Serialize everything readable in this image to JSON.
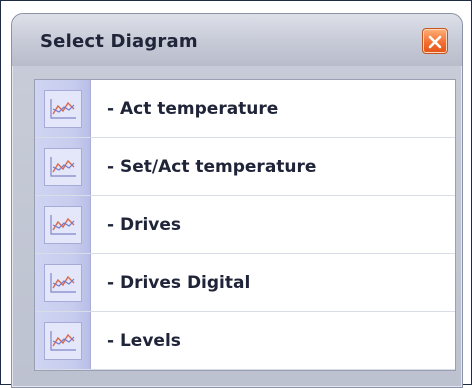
{
  "dialog": {
    "title": "Select Diagram",
    "close_icon": "close-x-icon",
    "accent_color": "#f26a2c"
  },
  "items": [
    {
      "label": "- Act temperature",
      "icon": "line-chart-icon"
    },
    {
      "label": "- Set/Act temperature",
      "icon": "line-chart-icon"
    },
    {
      "label": "- Drives",
      "icon": "line-chart-icon"
    },
    {
      "label": "- Drives Digital",
      "icon": "line-chart-icon"
    },
    {
      "label": "- Levels",
      "icon": "line-chart-icon"
    }
  ]
}
